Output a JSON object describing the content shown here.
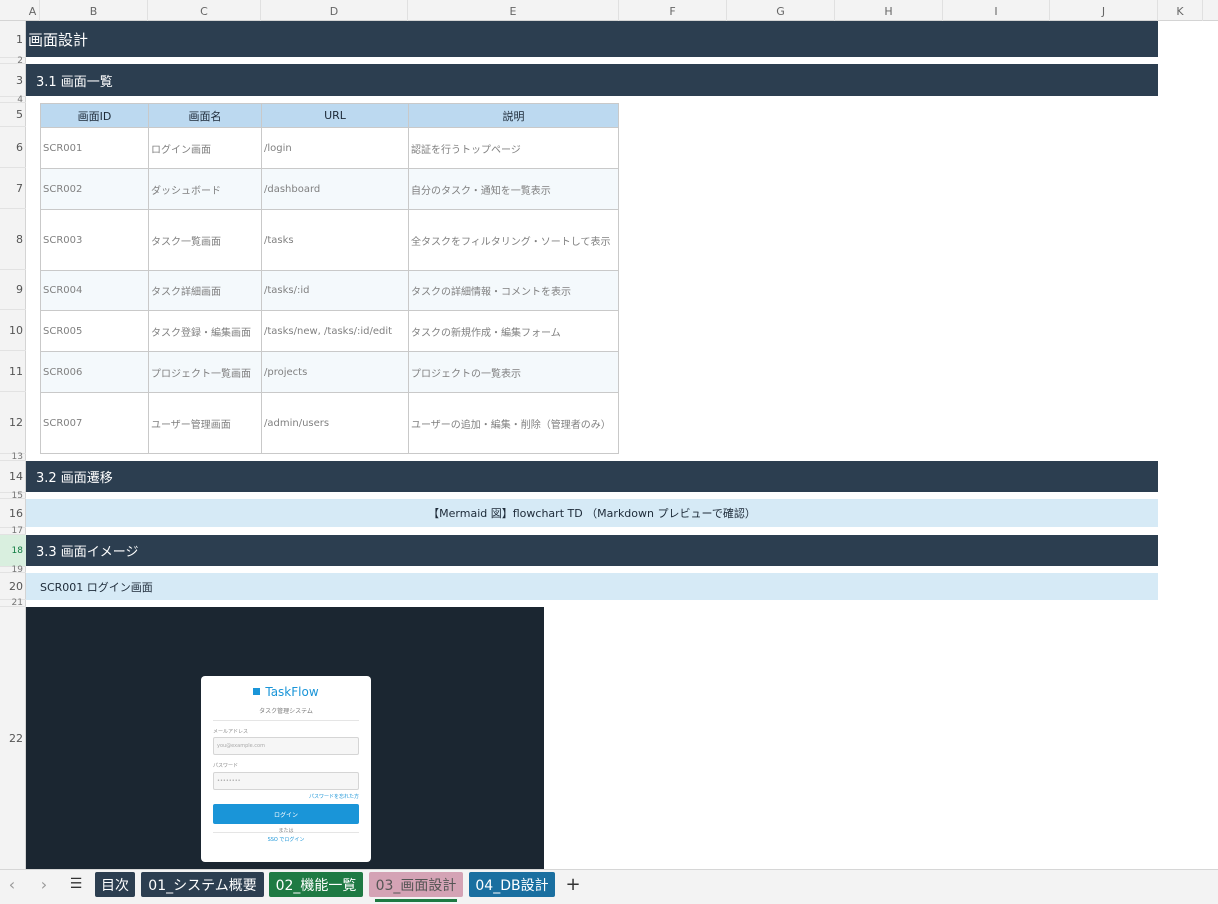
{
  "columns": [
    "A",
    "B",
    "C",
    "D",
    "E",
    "F",
    "G",
    "H",
    "I",
    "J",
    "K"
  ],
  "rows": [
    "1",
    "2",
    "3",
    "4",
    "5",
    "6",
    "7",
    "8",
    "9",
    "10",
    "11",
    "12",
    "13",
    "14",
    "15",
    "16",
    "17",
    "18",
    "19",
    "20",
    "21",
    "22"
  ],
  "sheet": {
    "title": "画面設計",
    "section1": "3.1 画面一覧",
    "table_headers": [
      "画面ID",
      "画面名",
      "URL",
      "説明"
    ],
    "table_rows": [
      [
        "SCR001",
        "ログイン画面",
        "/login",
        "認証を行うトップページ"
      ],
      [
        "SCR002",
        "ダッシュボード",
        "/dashboard",
        "自分のタスク・通知を一覧表示"
      ],
      [
        "SCR003",
        "タスク一覧画面",
        "/tasks",
        "全タスクをフィルタリング・ソートして表示"
      ],
      [
        "SCR004",
        "タスク詳細画面",
        "/tasks/:id",
        "タスクの詳細情報・コメントを表示"
      ],
      [
        "SCR005",
        "タスク登録・編集画面",
        "/tasks/new, /tasks/:id/edit",
        "タスクの新規作成・編集フォーム"
      ],
      [
        "SCR006",
        "プロジェクト一覧画面",
        "/projects",
        "プロジェクトの一覧表示"
      ],
      [
        "SCR007",
        "ユーザー管理画面",
        "/admin/users",
        "ユーザーの追加・編集・削除（管理者のみ）"
      ]
    ],
    "section2": "3.2 画面遷移",
    "mermaid_note": "【Mermaid 図】flowchart TD （Markdown プレビューで確認）",
    "section3": "3.3 画面イメージ",
    "subsection": "SCR001 ログイン画面"
  },
  "mock": {
    "brand": "TaskFlow",
    "subtitle": "タスク管理システム",
    "email_label": "メールアドレス",
    "email_placeholder": "you@example.com",
    "password_label": "パスワード",
    "password_value": "••••••••",
    "forgot": "パスワードを忘れた方",
    "login_button": "ログイン",
    "or": "または",
    "sso": "SSO でログイン",
    "accent": "#1a95d8"
  },
  "tabs": [
    {
      "label": "目次",
      "color": "#2c3e50"
    },
    {
      "label": "01_システム概要",
      "color": "#2c3e50"
    },
    {
      "label": "02_機能一覧",
      "color": "#1e7a43"
    },
    {
      "label": "03_画面設計",
      "color": "#d4a3b5",
      "active": true
    },
    {
      "label": "04_DB設計",
      "color": "#1a6fa0"
    }
  ],
  "tabbar": {
    "prev_icon": "‹",
    "next_icon": "›",
    "menu_icon": "☰",
    "add_icon": "+"
  }
}
